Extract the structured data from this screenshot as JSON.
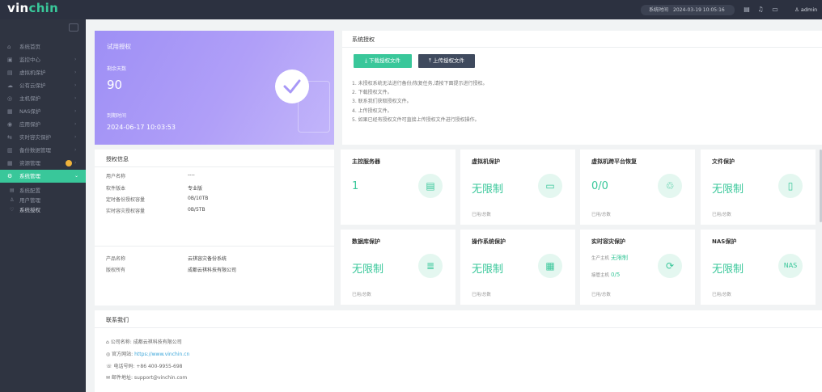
{
  "topbar": {
    "logo_main": "vin",
    "logo_accent": "chin",
    "sys_time_label": "系统时间",
    "sys_time_value": "2024-03-19 10:05:16",
    "admin_label": "admin"
  },
  "sidebar": {
    "items": [
      {
        "label": "系统首页",
        "icon": "home-icon"
      },
      {
        "label": "监控中心",
        "icon": "monitor-icon"
      },
      {
        "label": "虚拟机保护",
        "icon": "vm-icon"
      },
      {
        "label": "公有云保护",
        "icon": "cloud-icon"
      },
      {
        "label": "主机保护",
        "icon": "host-icon"
      },
      {
        "label": "NAS保护",
        "icon": "nas-icon"
      },
      {
        "label": "应用保护",
        "icon": "app-icon"
      },
      {
        "label": "实时容灾保护",
        "icon": "dr-icon"
      },
      {
        "label": "备份数据管理",
        "icon": "data-icon"
      },
      {
        "label": "资源管理",
        "icon": "resource-icon"
      },
      {
        "label": "系统管理",
        "icon": "settings-icon"
      }
    ],
    "sub_items": [
      {
        "label": "系统配置"
      },
      {
        "label": "用户管理"
      },
      {
        "label": "系统授权"
      }
    ]
  },
  "license_card": {
    "title": "试用授权",
    "days_label": "剩余天数",
    "days_value": "90",
    "expire_label": "到期时间",
    "expire_value": "2024-06-17 10:03:53"
  },
  "system_license": {
    "title": "系统授权",
    "download_button": "下载授权文件",
    "upload_button": "上传授权文件",
    "steps": [
      "1. 未授权系统无法进行备份/恢复任务,请按下面提示进行授权。",
      "2. 下载授权文件。",
      "3. 联系我们获取授权文件。",
      "4. 上传授权文件。",
      "5. 如果已经有授权文件可直接上传授权文件进行授权操作。"
    ]
  },
  "auth_info": {
    "title": "授权信息",
    "rows": [
      {
        "label": "用户名称",
        "value": "----"
      },
      {
        "label": "软件版本",
        "value": "专业版"
      },
      {
        "label": "定时备份授权容量",
        "value": "0B/10TB"
      },
      {
        "label": "实时容灾授权容量",
        "value": "0B/5TB"
      }
    ],
    "product_label": "产品名称",
    "product_value": "云祺容灾备份系统",
    "owner_label": "版权所有",
    "owner_value": "成都云祺科技有限公司"
  },
  "cards": [
    {
      "title": "主控服务器",
      "value": "1",
      "footer": "",
      "icon": "server-icon"
    },
    {
      "title": "虚拟机保护",
      "value": "无限制",
      "footer": "已用/总数",
      "icon": "vm-icon"
    },
    {
      "title": "虚拟机跨平台恢复",
      "value": "0/0",
      "footer": "已用/总数",
      "icon": "recovery-icon"
    },
    {
      "title": "文件保护",
      "value": "无限制",
      "footer": "已用/总数",
      "icon": "file-icon"
    },
    {
      "title": "数据库保护",
      "value": "无限制",
      "footer": "已用/总数",
      "icon": "database-icon"
    },
    {
      "title": "操作系统保护",
      "value": "无限制",
      "footer": "已用/总数",
      "icon": "os-icon"
    },
    {
      "title": "实时容灾保护",
      "value": "",
      "footer": "已用/总数",
      "icon": "realtime-icon",
      "sub1_label": "生产主机",
      "sub1_value": "无限制",
      "sub2_label": "接管主机",
      "sub2_value": "0/5"
    },
    {
      "title": "NAS保护",
      "value": "无限制",
      "footer": "已用/总数",
      "icon": "nas-icon"
    }
  ],
  "contact": {
    "title": "联系我们",
    "company_label": "公司名称:",
    "company_value": "成都云祺科技有限公司",
    "website_label": "官方网站:",
    "website_value": "https://www.vinchin.cn",
    "phone_label": "电话号码:",
    "phone_value": "+86 400-9955-698",
    "email_label": "邮件地址:",
    "email_value": "support@vinchin.com"
  },
  "colors": {
    "accent": "#39c79a",
    "sidebar_bg": "#2f3441",
    "topbar_bg": "#2c3140",
    "license_purple": "#a898f7"
  }
}
